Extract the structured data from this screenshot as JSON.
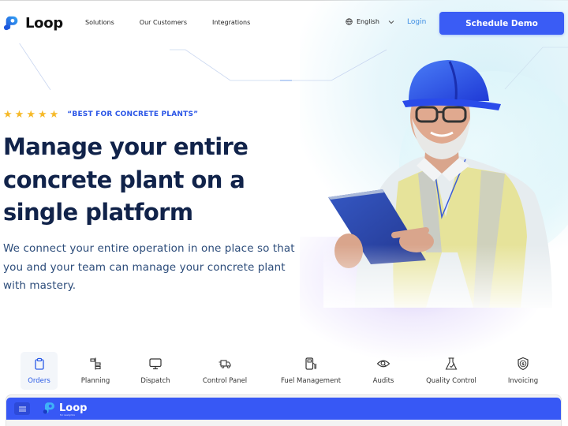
{
  "header": {
    "brand": "Loop",
    "nav": [
      "Solutions",
      "Our Customers",
      "Integrations"
    ],
    "language": "English",
    "login_label": "Login",
    "cta_label": "Schedule Demo"
  },
  "hero": {
    "rating_stars": 5,
    "tagline": "“BEST FOR CONCRETE PLANTS”",
    "headline_lines": [
      "Manage your entire",
      "concrete plant on a",
      "single platform"
    ],
    "subtext_lines": [
      "We connect your entire operation in one place so that",
      "you and your team can manage your concrete plant",
      "with mastery."
    ]
  },
  "features": [
    {
      "label": "Orders",
      "icon": "clipboard-icon",
      "active": true
    },
    {
      "label": "Planning",
      "icon": "planning-icon",
      "active": false
    },
    {
      "label": "Dispatch",
      "icon": "monitor-icon",
      "active": false
    },
    {
      "label": "Control Panel",
      "icon": "truck-icon",
      "active": false
    },
    {
      "label": "Fuel Management",
      "icon": "fuel-pump-icon",
      "active": false
    },
    {
      "label": "Audits",
      "icon": "eye-search-icon",
      "active": false
    },
    {
      "label": "Quality Control",
      "icon": "flask-check-icon",
      "active": false
    },
    {
      "label": "Invoicing",
      "icon": "shield-dollar-icon",
      "active": false
    }
  ],
  "preview": {
    "brand": "Loop",
    "brand_sub": "for readymix"
  },
  "colors": {
    "primary": "#3a5cf5",
    "headline": "#11234a",
    "body_text": "#2c4c7a",
    "tagline": "#2a55e6",
    "star": "#f6b928",
    "login": "#3d8de3"
  }
}
